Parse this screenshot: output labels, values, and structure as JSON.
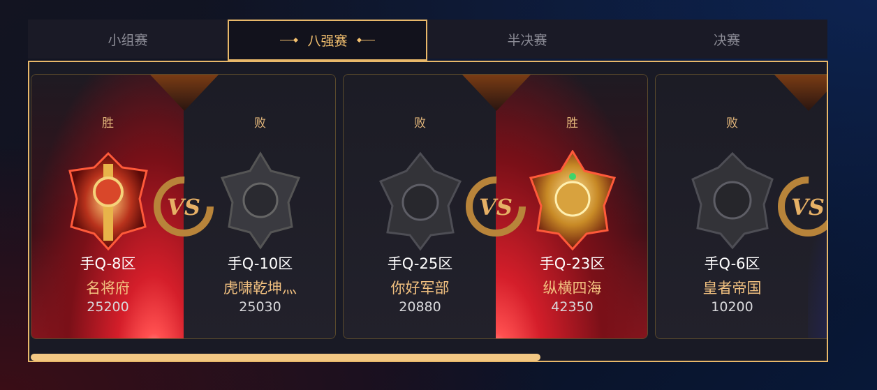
{
  "tabs": [
    {
      "label": "小组赛",
      "active": false
    },
    {
      "label": "八强赛",
      "active": true
    },
    {
      "label": "半决赛",
      "active": false
    },
    {
      "label": "决赛",
      "active": false
    }
  ],
  "matches": [
    {
      "vs_label": "VS",
      "left": {
        "result": "胜",
        "zone": "手Q-8区",
        "guild": "名将府",
        "score": "25200",
        "emblem": "red-gold-hammer-emblem-icon"
      },
      "right": {
        "result": "败",
        "zone": "手Q-10区",
        "guild": "虎啸乾坤灬",
        "score": "25030",
        "emblem": "grey-demon-emblem-icon"
      }
    },
    {
      "vs_label": "VS",
      "left": {
        "result": "败",
        "zone": "手Q-25区",
        "guild": "你好军部",
        "score": "20880",
        "emblem": "grey-warlord-emblem-icon"
      },
      "right": {
        "result": "胜",
        "zone": "手Q-23区",
        "guild": "纵横四海",
        "score": "42350",
        "emblem": "gold-lion-emblem-icon"
      }
    },
    {
      "vs_label": "VS",
      "left": {
        "result": "败",
        "zone": "手Q-6区",
        "guild": "皇者帝国",
        "score": "10200",
        "emblem": "grey-wolf-emblem-icon"
      }
    }
  ],
  "colors": {
    "accent": "#e8b86a",
    "win_red": "#d41e2a",
    "text_gold": "#f2c180"
  },
  "scroll_fraction": 0.64
}
